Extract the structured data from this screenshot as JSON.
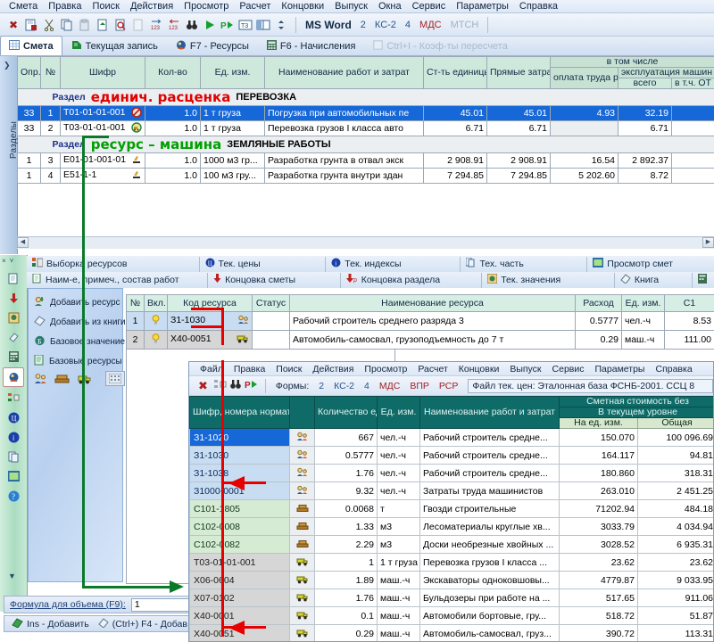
{
  "main_window": {
    "menu": [
      "Смета",
      "Правка",
      "Поиск",
      "Действия",
      "Просмотр",
      "Расчет",
      "Концовки",
      "Выпуск",
      "Окна",
      "Сервис",
      "Параметры",
      "Справка"
    ],
    "toolbar": {
      "icons": [
        "close-red-x-icon",
        "save-doc-icon",
        "cut-scissors-icon",
        "copy-icon",
        "paste-icon",
        "export-doc-icon",
        "find-in-doc-icon",
        "doc-disabled-icon",
        "indent-right-icon",
        "indent-left-icon",
        "binoculars-icon",
        "play-green-icon",
        "play-step-icon",
        "t3-icon",
        "columns-icon",
        "spinner-icon"
      ],
      "word_label": "MS Word",
      "forms": [
        "2",
        "КС-2",
        "4",
        "МДС",
        "МТСН"
      ]
    },
    "tabs": [
      {
        "label": "Смета",
        "icon": "grid-icon",
        "active": true,
        "disabled": false
      },
      {
        "label": "Текущая запись",
        "icon": "record-icon",
        "active": false,
        "disabled": false
      },
      {
        "label": "F7 - Ресурсы",
        "icon": "resources-icon",
        "active": false,
        "disabled": false
      },
      {
        "label": "F6 - Начисления",
        "icon": "calc-icon",
        "active": false,
        "disabled": false
      },
      {
        "label": "Ctrl+I - Коэф-ты пересчета",
        "icon": "coef-icon",
        "active": false,
        "disabled": true
      }
    ],
    "rail_label": "Разделы"
  },
  "top_grid": {
    "headers": {
      "opr": "Опр.",
      "num": "№",
      "code": "Шифр",
      "qty": "Кол-во",
      "unit": "Ед. изм.",
      "name": "Наименование работ и затрат",
      "unit_cost": "Ст-ть единицы",
      "direct": "Прямые затраты, руб.",
      "group": "в том числе",
      "wages": "оплата труда рабочих",
      "machines": "эксплуатация машин",
      "m_total": "всего",
      "m_incl": "в т.ч. ОТ"
    },
    "sections": [
      {
        "keyword": "Раздел",
        "callout": "единич. расценка",
        "callout_color": "#e10000",
        "name": "ПЕРЕВОЗКА"
      },
      {
        "keyword": "Раздел",
        "callout": "ресурс – машина",
        "callout_color": "#00a000",
        "name": "ЗЕМЛЯНЫЕ РАБОТЫ"
      }
    ],
    "rows_section1": [
      {
        "opr": "33",
        "num": "1",
        "code": "Т01-01-01-001",
        "icon": "no-entry-icon",
        "qty": "1.0",
        "unit": "1 т груза",
        "name": "Погрузка при автомобильных пе",
        "unit_cost": "45.01",
        "direct": "45.01",
        "wages": "4.93",
        "m_total": "32.19",
        "selected": true
      },
      {
        "opr": "33",
        "num": "2",
        "code": "Т03-01-01-001",
        "icon": "truck-circle-icon",
        "qty": "1.0",
        "unit": "1 т груза",
        "name": "Перевозка грузов I класса авто",
        "unit_cost": "6.71",
        "direct": "6.71",
        "wages": "",
        "m_total": "6.71",
        "selected": false
      }
    ],
    "rows_section2": [
      {
        "opr": "1",
        "num": "3",
        "code": "Е01-01-001-01",
        "icon": "excavator-icon",
        "qty": "1.0",
        "unit": "1000 м3 гр...",
        "name": "Разработка грунта в отвал экск",
        "unit_cost": "2 908.91",
        "direct": "2 908.91",
        "wages": "16.54",
        "m_total": "2 892.37",
        "selected": false
      },
      {
        "opr": "1",
        "num": "4",
        "code": "Е51-1-1",
        "icon": "excavator-icon",
        "qty": "1.0",
        "unit": "100 м3 гру...",
        "name": "Разработка грунта внутри здан",
        "unit_cost": "7 294.85",
        "direct": "7 294.85",
        "wages": "5 202.60",
        "m_total": "8.72",
        "selected": false
      }
    ]
  },
  "mid_panel": {
    "tabs_row1": [
      {
        "label": "Выборка ресурсов",
        "icon": "resource-picker-icon"
      },
      {
        "label": "Тек. цены",
        "icon": "price-circle-icon"
      },
      {
        "label": "Тек. индексы",
        "icon": "info-circle-icon"
      },
      {
        "label": "Тех. часть",
        "icon": "pages-icon"
      },
      {
        "label": "Просмотр смет",
        "icon": "preview-icon"
      }
    ],
    "tabs_row2": [
      {
        "label": "Наим-е, примеч., состав работ",
        "icon": "note-icon"
      },
      {
        "label": "Концовка сметы",
        "icon": "arrow-down-red-icon"
      },
      {
        "label": "Концовка раздела",
        "icon": "arrow-down-p-icon"
      },
      {
        "label": "Тек. значения",
        "icon": "values-icon"
      },
      {
        "label": "Книга",
        "icon": "book-icon"
      }
    ],
    "rail_icons": [
      "doc-icon",
      "arrow-down-red-icon",
      "stamp-icon",
      "eraser-icon",
      "calculator-icon",
      "resource-picker-icon",
      "structure-icon",
      "price-circle-icon",
      "info-circle-icon",
      "pages-icon",
      "preview-icon",
      "help-icon"
    ],
    "side_actions": [
      {
        "label": "Добавить ресурс",
        "icon": "add-resource-icon"
      },
      {
        "label": "Добавить из книги",
        "icon": "book-add-icon"
      },
      {
        "label": "Базовое значение",
        "icon": "base-value-icon"
      },
      {
        "label": "Базовые ресурсы",
        "icon": "base-resources-icon"
      }
    ],
    "mini_icons": [
      "workers-icon",
      "materials-icon",
      "machines-icon"
    ],
    "keypad_icon": "keypad-icon",
    "res_headers": {
      "num": "№",
      "incl": "Вкл.",
      "code": "Код ресурса",
      "status": "Статус",
      "name": "Наименование ресурса",
      "consumption": "Расход",
      "unit": "Ед. изм.",
      "c1": "С1"
    },
    "res_rows": [
      {
        "num": "1",
        "incl": "bulb-icon",
        "code": "З1-1030",
        "icon": "workers-icon",
        "status": "",
        "name": "Рабочий строитель среднего разряда 3",
        "consumption": "0.5777",
        "unit": "чел.-ч",
        "c1": "8.53"
      },
      {
        "num": "2",
        "incl": "bulb-icon",
        "code": "Х40-0051",
        "icon": "machines-icon",
        "status": "",
        "name": "Автомобиль-самосвал, грузоподъемность до 7 т",
        "consumption": "0.29",
        "unit": "маш.-ч",
        "c1": "111.00"
      }
    ],
    "formula_label": "Формула для объема (F9):",
    "formula_value": "1",
    "status_items": [
      {
        "label": "Ins - Добавить",
        "icon": "insert-icon"
      },
      {
        "label": "(Ctrl+) F4 - Добав",
        "icon": "eraser-icon"
      }
    ]
  },
  "child_window": {
    "menu": [
      "Файл",
      "Правка",
      "Поиск",
      "Действия",
      "Просмотр",
      "Расчет",
      "Концовки",
      "Выпуск",
      "Сервис",
      "Параметры",
      "Справка"
    ],
    "toolbar_icons": [
      "close-red-x-icon",
      "structure-icon",
      "binoculars-icon",
      "play-step-icon"
    ],
    "forms_label": "Формы:",
    "forms": [
      "2",
      "КС-2",
      "4",
      "МДС",
      "ВПР",
      "РСР"
    ],
    "path_text": "Файл тек. цен: Эталонная база ФСНБ-2001. ССЦ 8",
    "headers": {
      "code": "Шифр, номера нормативов и коды ресурсов",
      "qty": "Количество единиц по проектным данным",
      "unit": "Ед. изм.",
      "name": "Наименование работ и затрат",
      "cost_group": "Сметная стоимость без",
      "current_level": "В текущем уровне",
      "per_unit": "На ед. изм.",
      "total": "Общая"
    },
    "rows": [
      {
        "code": "З1-1020",
        "icon": "workers-icon",
        "group": "lab",
        "qty": "667",
        "unit": "чел.-ч",
        "name": "Рабочий строитель средне...",
        "per_unit": "150.070",
        "total": "100 096.69",
        "selected": true
      },
      {
        "code": "З1-1030",
        "icon": "workers-icon",
        "group": "lab",
        "qty": "0.5777",
        "unit": "чел.-ч",
        "name": "Рабочий строитель средне...",
        "per_unit": "164.117",
        "total": "94.81",
        "selected": false
      },
      {
        "code": "З1-1038",
        "icon": "workers-icon",
        "group": "lab",
        "qty": "1.76",
        "unit": "чел.-ч",
        "name": "Рабочий строитель средне...",
        "per_unit": "180.860",
        "total": "318.31",
        "selected": false
      },
      {
        "code": "З1000-0001",
        "icon": "workers-icon",
        "group": "lab",
        "qty": "9.32",
        "unit": "чел.-ч",
        "name": "Затраты труда машинистов",
        "per_unit": "263.010",
        "total": "2 451.25",
        "selected": false
      },
      {
        "code": "С101-1805",
        "icon": "materials-icon",
        "group": "mat",
        "qty": "0.0068",
        "unit": "т",
        "name": "Гвозди строительные",
        "per_unit": "71202.94",
        "total": "484.18",
        "selected": false
      },
      {
        "code": "С102-0008",
        "icon": "materials-icon",
        "group": "mat",
        "qty": "1.33",
        "unit": "м3",
        "name": "Лесоматериалы круглые хв...",
        "per_unit": "3033.79",
        "total": "4 034.94",
        "selected": false
      },
      {
        "code": "С102-0082",
        "icon": "materials-icon",
        "group": "mat",
        "qty": "2.29",
        "unit": "м3",
        "name": "Доски необрезные хвойных ...",
        "per_unit": "3028.52",
        "total": "6 935.31",
        "selected": false
      },
      {
        "code": "Т03-01-01-001",
        "icon": "machines-icon",
        "group": "mch",
        "qty": "1",
        "unit": "1 т груза",
        "name": "Перевозка грузов I класса ...",
        "per_unit": "23.62",
        "total": "23.62",
        "selected": false
      },
      {
        "code": "Х06-0604",
        "icon": "machines-icon",
        "group": "mch",
        "qty": "1.89",
        "unit": "маш.-ч",
        "name": "Экскаваторы одноковшовы...",
        "per_unit": "4779.87",
        "total": "9 033.95",
        "selected": false
      },
      {
        "code": "Х07-0102",
        "icon": "machines-icon",
        "group": "mch",
        "qty": "1.76",
        "unit": "маш.-ч",
        "name": "Бульдозеры при работе на ...",
        "per_unit": "517.65",
        "total": "911.06",
        "selected": false
      },
      {
        "code": "Х40-0001",
        "icon": "machines-icon",
        "group": "mch",
        "qty": "0.1",
        "unit": "маш.-ч",
        "name": "Автомобили бортовые, гру...",
        "per_unit": "518.72",
        "total": "51.87",
        "selected": false
      },
      {
        "code": "Х40-0051",
        "icon": "machines-icon",
        "group": "mch",
        "qty": "0.29",
        "unit": "маш.-ч",
        "name": "Автомобиль-самосвал, груз...",
        "per_unit": "390.72",
        "total": "113.31",
        "selected": false
      }
    ]
  },
  "annotations": {
    "green_color": "#0a7a2a",
    "red_color": "#e60000"
  }
}
